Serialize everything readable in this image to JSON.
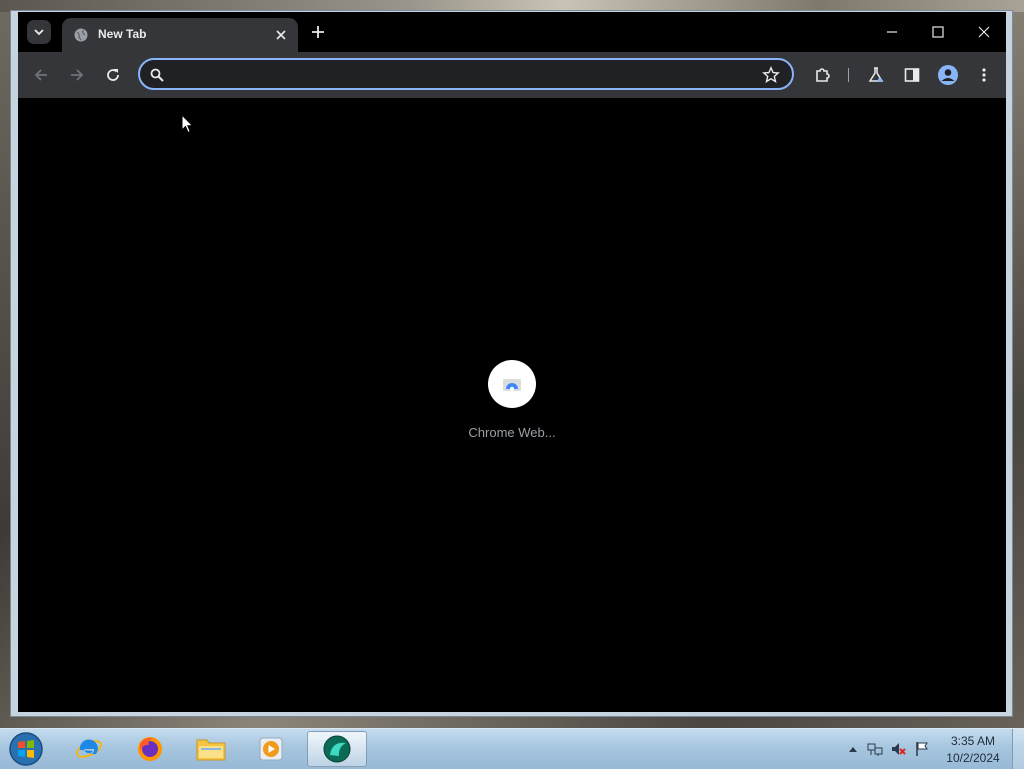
{
  "browser": {
    "tab": {
      "title": "New Tab"
    },
    "omnibox": {
      "value": "",
      "placeholder": ""
    },
    "accent_color": "#8ab4f8"
  },
  "new_tab_page": {
    "shortcuts": [
      {
        "label": "Chrome Web...",
        "icon": "chrome-web-store-icon"
      }
    ]
  },
  "taskbar": {
    "pinned": [
      "internet-explorer-icon",
      "firefox-icon",
      "file-explorer-icon",
      "media-player-icon",
      "chrome-app-icon"
    ],
    "clock": {
      "time": "3:35 AM",
      "date": "10/2/2024"
    },
    "tray_icons": [
      "show-hidden-icons-arrow",
      "network-icon",
      "volume-muted-icon",
      "action-center-flag-icon"
    ]
  }
}
